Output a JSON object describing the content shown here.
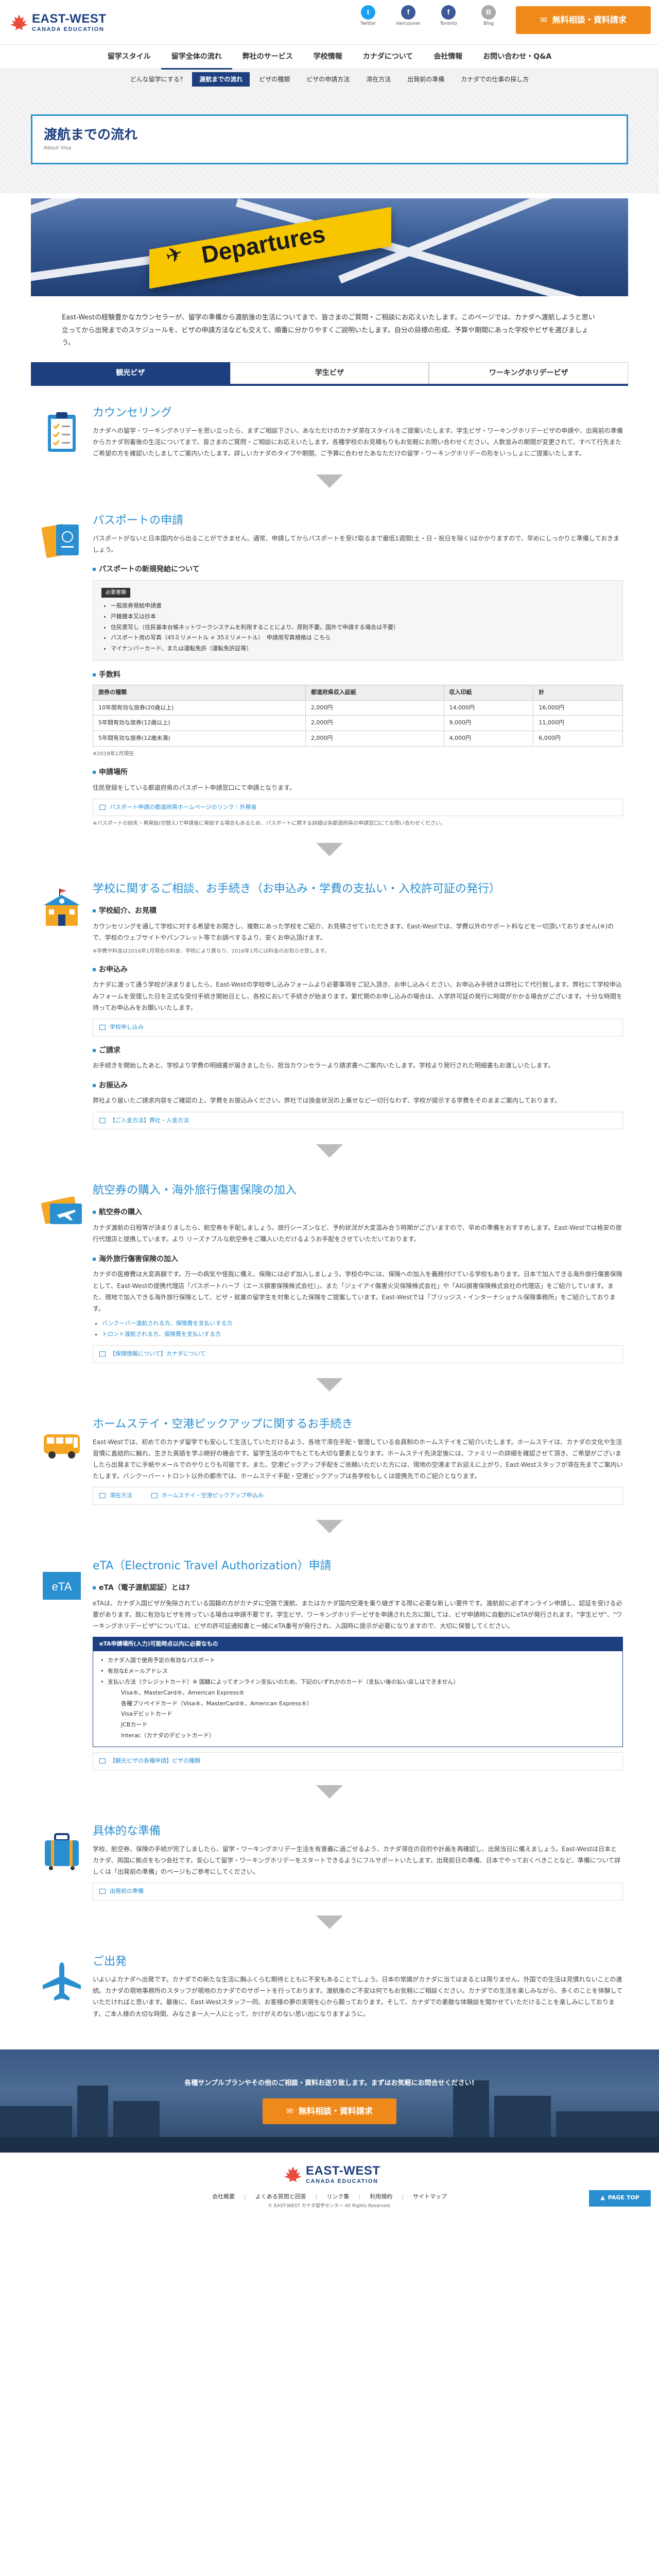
{
  "header": {
    "logo_line1": "EAST-WEST",
    "logo_line2": "CANADA EDUCATION",
    "sns": [
      {
        "label": "Twitter",
        "icon": "twitter-icon",
        "glyph": "t",
        "color": "#1da1f2"
      },
      {
        "label": "Vancouver",
        "icon": "facebook-icon",
        "glyph": "f",
        "color": "#3b5998"
      },
      {
        "label": "Toronto",
        "icon": "facebook-icon",
        "glyph": "f",
        "color": "#3b5998"
      },
      {
        "label": "Blog",
        "icon": "blog-icon",
        "glyph": "B",
        "color": "#aaaaaa"
      }
    ],
    "cta_label": "無料相談・資料請求"
  },
  "nav": {
    "items": [
      "留学スタイル",
      "留学全体の流れ",
      "弊社のサービス",
      "学校情報",
      "カナダについて",
      "会社情報",
      "お問い合わせ・Q&A"
    ],
    "active": 1
  },
  "subnav": {
    "items": [
      "どんな留学にする?",
      "渡航までの流れ",
      "ビザの種類",
      "ビザの申請方法",
      "滞在方法",
      "出発前の準備",
      "カナダでの仕事の探し方"
    ],
    "active": 1
  },
  "title": {
    "main": "渡航までの流れ",
    "sub": "About Visa"
  },
  "hero": {
    "sign_text": "Departures"
  },
  "intro": "East-Westの経験豊かなカウンセラーが、留学の準備から渡航後の生活についてまで、皆さまのご質問・ご相談にお応えいたします。このページでは、カナダへ渡航しようと思い立ってから出発までのスケジュールを、ビザの申請方法なども交えて、順番に分かりやすくご説明いたします。自分の目標の形成、予算や期間にあった学校やビザを選びましょう。",
  "tabs": [
    "観光ビザ",
    "学生ビザ",
    "ワーキングホリデービザ"
  ],
  "steps": {
    "counseling": {
      "title": "カウンセリング",
      "text": "カナダへの留学・ワーキングホリデーを思い立ったら、まずご相談下さい。あなただけのカナダ滞在スタイルをご提案いたします。学生ビザ・ワーキングホリデービザの申請や、出発前の準備からカナダ到着後の生活についてまで、皆さまのご質問・ご相談にお応えいたします。各種学校のお見積もりもお気軽にお問い合わせください。人数並みの期間が変更されて、すべて行先またご希望の方を確認いたしましてご案内いたします。詳しいカナダのタイプや期間、ご予算に合わせたあなただけの留学・ワーキングホリデーの形をいっしょにご提案いたします。"
    },
    "passport": {
      "title": "パスポートの申請",
      "text": "パスポートがないと日本国内から出ることができません。通常、申請してからパスポートを受け取るまで最低1週間(土・日・祝日を除く)はかかりますので、早めにしっかりと準備しておきましょう。",
      "h_docs": "パスポートの新規発給について",
      "docs_tag": "必要書類",
      "docs": [
        "一般旅券発給申請書",
        "戸籍謄本又は抄本",
        "住民票写し（住民基本台帳ネットワークシステムを利用することにより、原則不要。国外で申請する場合は不要）",
        "パスポート用の写真（45ミリメートル × 35ミリメートル）　申請用写真規格は こちら",
        "マイナンバーカード、または運転免許（運転免許証等）"
      ],
      "h_fee": "手数料",
      "fee_headers": [
        "旅券の種類",
        "都道府県収入証紙",
        "収入印紙",
        "計"
      ],
      "fee_rows": [
        [
          "10年間有効な旅券(20歳以上)",
          "2,000円",
          "14,000円",
          "16,000円"
        ],
        [
          "5年間有効な旅券(12歳以上)",
          "2,000円",
          "9,000円",
          "11,000円"
        ],
        [
          "5年間有効な旅券(12歳未満)",
          "2,000円",
          "4,000円",
          "6,000円"
        ]
      ],
      "fee_note": "※2018年1月現在",
      "h_place": "申請場所",
      "place_text": "住民登録をしている都道府県のパスポート申請窓口にて申請となります。",
      "place_link": "パスポート申請の都道府県ホームページのリンク｜外務省",
      "note": "※パスポートの紛失・再発給(切替え)で申請後に発給する場合もあるため、パスポートに関する詳細は各都道府県の申請窓口にてお問い合わせください。"
    },
    "school": {
      "title": "学校に関するご相談、お手続き（お申込み・学費の支払い・入校許可証の発行）",
      "h1": "学校紹介、お見積",
      "t1": "カウンセリングを通して学校に対する希望をお聞きし、複数にあった学校をご紹介、お見積させていただきます。East-Westでは、学費以外のサポート料などを一切頂いておりません(※)ので、学校のウェブサイトやパンフレット等でお調べするより、安くお申込頂けます。",
      "n1": "※学費や料金は2016年1月現在の料金、学校により異なり、2016年1月には料金のお知らせ致します。",
      "h2": "お申込み",
      "t2": "カナダに渡って通う学校が決まりましたら、East-Westの学校申し込みフォームより必要事項をご記入頂き、お申し込みください。お申込み手続きは弊社にて代行致します。弊社にて学校申込みフォームを受理した日を正式な受付手続き開始日とし、各校において手続きが始まります。繁忙期のお申し込みの場合は、入学許可証の発行に時間がかかる場合がございます。十分な時間を持ってお申込みをお願いいたします。",
      "l2": "学校申し込み",
      "h3": "ご請求",
      "t3": "お手続きを開始したあと、学校より学費の明細書が届きましたら、担当カウンセラーより請求書へご案内いたします。学校より発行された明細書もお渡しいたします。",
      "h4": "お振込み",
      "t4": "弊社より届いたご請求内容をご確認の上、学費をお振込みください。弊社では換金状況の上乗せなど一切行なわず、学校が提示する学費をそのままご案内しております。",
      "l4": "【ご入金方法】弊社・入金方法"
    },
    "flight": {
      "title": "航空券の購入・海外旅行傷害保険の加入",
      "h1": "航空券の購入",
      "t1": "カナダ渡航の日程等が決まりましたら、航空券を手配しましょう。旅行シーズンなど、予約状況が大変混み合う時期がございますので、早めの準備をおすすめします。East-Westでは格安の旅行代理店と提携しています。より リーズナブルな航空券をご購入いただけるようお手配をさせていただいております。",
      "h2": "海外旅行傷害保険の加入",
      "t2": "カナダの医療費は大変高額です。万一の病気や怪我に備え、保険には必ず加入しましょう。学校の中には、保険への加入を義務付けている学校もあります。日本で加入できる海外旅行傷害保険として、East-Westの提携代理店「パスポートハーブ（エース損害保険株式会社）」、また「ジェイアイ傷害火災保険株式会社」や「AIG損害保険株式会社の代理店」をご紹介しています。また、現地で加入できる海外旅行保険として、ビザ・就業の留学生を対象とした保険をご提案しています。East-Westでは「ブリッジス・インターナショナル保険事務所」をご紹介しております。",
      "links": [
        "バンクーバー渡航される方、保険費を支払いする方",
        "トロント渡航される方、保険費を支払いする方"
      ],
      "l_main": "【保険情報について】カナダについて"
    },
    "homestay": {
      "title": "ホームステイ・空港ピックアップに関するお手続き",
      "text": "East-Westでは、初めてのカナダ留学でも安心して生活していただけるよう、各地で滞在手配・管理している会員制のホームステイをご紹介いたします。ホームステイは、カナダの文化や生活習慣に直結的に触れ、生きた英語を学ぶ絶好の機会です。留学生活の中でもとても大切な要素となります。ホームステイ先決定後には、ファミリーの詳細を確認させて頂き、ご希望がございましたら出発までに手紙やメールでのやりとりも可能です。また、空港ピックアップ手配をご依頼いただいた方には、現地の空港までお迎えに上がり、East-Westスタッフが滞在先までご案内いたします。バンクーバー・トロント以外の都市では、ホームステイ手配・空港ピックアップは各学校もしくは提携先でのご紹介となります。",
      "links": [
        "滞在方法",
        "ホームステイ・空港ピックアップ申込み"
      ]
    },
    "eta": {
      "title": "eTA（Electronic Travel Authorization）申請",
      "h1": "eTA（電子渡航認証）とは?",
      "t1": "eTAは、カナダ入国ビザが免除されている国籍の方がカナダに空路で渡航、またはカナダ国内空港を乗り継ぎする際に必要な新しい要件です。渡航前に必ずオンライン申請し、認証を受ける必要があります。既に有効なビザを持っている場合は申請不要です。学生ビザ、ワーキングホリデービザを申請された方に関しては、ビザ申請時に自動的にeTAが発行されます。\"学生ビザ\"、\"ワーキングホリデービザ\"については、ビザの許可証通知書と一緒にeTA番号が発行され、入国時に提示が必要になりますので、大切に保管してください。",
      "box_head": "eTA申請場所(入力)可能時点以内に必要なもの",
      "box_items": [
        "カナダ入国で使用予定の有効なパスポート",
        "有効なEメールアドレス",
        "支払い方法（クレジットカード）※ 国籍によってオンライン支払いのため、下記のいずれかのカード（支払い後の払い戻しはできません）",
        "Visa®、MasterCard®、American Express®",
        "各種プリペイドカード（Visa®、MasterCard®、American Express®）",
        "Visaデビットカード",
        "JCBカード",
        "Interac（カナダのデビットカード）"
      ],
      "link": "【観光ビザの各種申請】ビザの種類"
    },
    "prepare": {
      "title": "具体的な準備",
      "text": "学校、航空券、保険の手続が完了しましたら、留学・ワーキングホリデー生活を有意義に過ごせるよう、カナダ滞在の目的や計画を再確認し、出発当日に備えましょう。East-Westは日本とカナダ、両国に拠点をもつ会社です。安心して留学・ワーキングホリデーをスタートできるようにフルサポートいたします。出発前日の準備、日本でやっておくべきことなど、準備について詳しくは「出発前の準備」のページもご参考にしてください。",
      "link": "出発前の準備"
    },
    "depart": {
      "title": "ご出発",
      "text": "いよいよカナダへ出発です。カナダでの新たな生活に胸ふくらむ期待とともに不安もあることでしょう。日本の常識がカナダに当てはまるとは限りません。外国での生活は見慣れないことの連続。カナダの現地事務所のスタッフが現地のカナダでのサポートを行っております。渡航後のご不安は何でもお気軽にご相談ください。カナダでの生活を楽しみながら、多くのことを体験していただければと思います。最後に、East-Westスタッフ一同、お客様の夢の実現を心から願っております。そして、カナダでの素敵な体験談を聞かせていただけることを楽しみにしております。ご本人様の大切な時間、みなさま一人一人にとって、かけがえのない思い出になりますように。"
    }
  },
  "cta_band": {
    "text": "各種サンプルプランやその他のご相談・資料お送り致します。まずはお気軽にお問合せください!",
    "button": "無料相談・資料請求"
  },
  "footer": {
    "links": [
      "会社概要",
      "よくある質問と回答",
      "リンク集",
      "利用規約",
      "サイトマップ"
    ],
    "copyright": "© EAST-WEST カナダ留学センター All Rights Reserved.",
    "pagetop": "PAGE TOP"
  }
}
